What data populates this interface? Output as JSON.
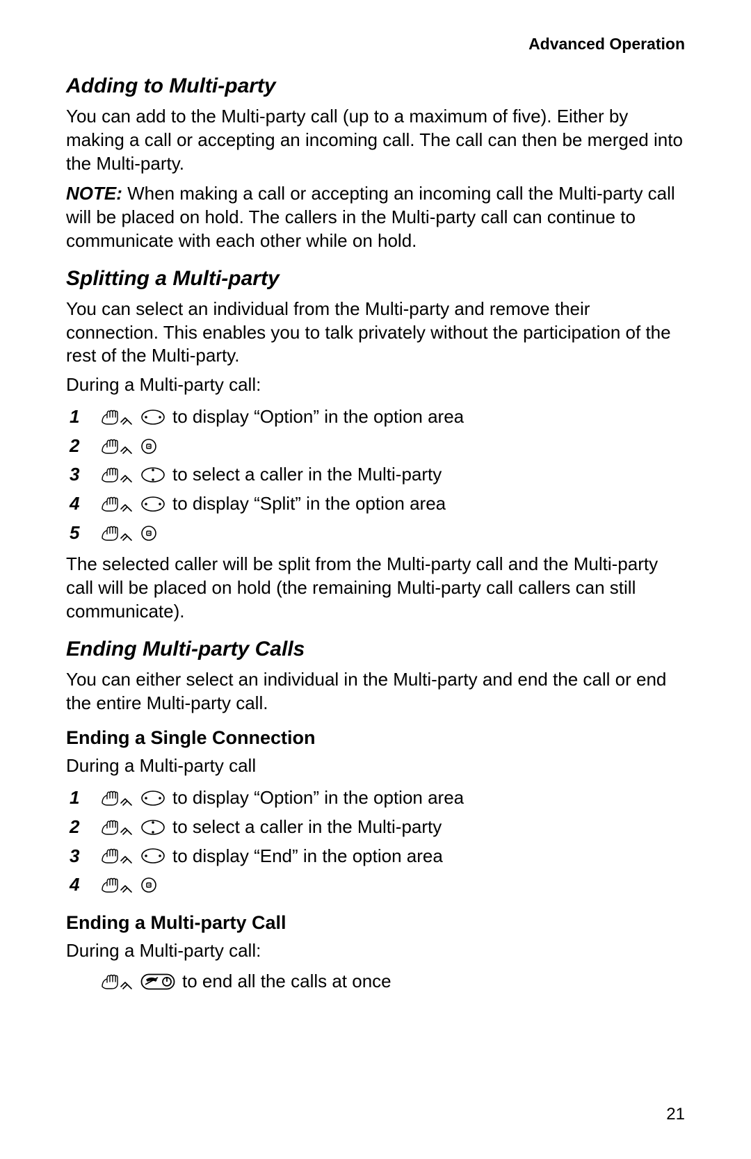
{
  "header": "Advanced Operation",
  "pageNumber": "21",
  "sections": {
    "adding": {
      "title": "Adding to Multi-party",
      "body": "You can add to the Multi-party call (up to a maximum of five). Either by making a call or accepting an incoming call. The call can then be merged into the Multi-party.",
      "noteLabel": "NOTE:",
      "noteBody": " When making a call or accepting an incoming call the Multi-party call will be placed on hold. The callers in the Multi-party call can continue to communicate with each other while on hold."
    },
    "splitting": {
      "title": "Splitting a Multi-party",
      "body": "You can select an individual from the Multi-party and remove their connection. This enables you to talk privately without the participation of the rest of the Multi-party.",
      "intro": "During a Multi-party call:",
      "steps": [
        {
          "n": "1",
          "text": " to display “Option” in the option area"
        },
        {
          "n": "2",
          "text": ""
        },
        {
          "n": "3",
          "text": " to select a caller in the Multi-party"
        },
        {
          "n": "4",
          "text": " to display “Split” in the option area"
        },
        {
          "n": "5",
          "text": ""
        }
      ],
      "after": "The selected caller will be split from the Multi-party call and the Multi-party call will be placed on hold (the remaining Multi-party call callers can still communicate)."
    },
    "ending": {
      "title": "Ending Multi-party Calls",
      "body": "You can either select an individual in the Multi-party and end the call or end the entire Multi-party call.",
      "sub1": {
        "title": "Ending a Single Connection",
        "intro": "During a Multi-party call",
        "steps": [
          {
            "n": "1",
            "text": " to display “Option” in the option area"
          },
          {
            "n": "2",
            "text": " to select a caller in the Multi-party"
          },
          {
            "n": "3",
            "text": " to display “End” in the option area"
          },
          {
            "n": "4",
            "text": ""
          }
        ]
      },
      "sub2": {
        "title": "Ending a Multi-party Call",
        "intro": "During a Multi-party call:",
        "stepText": " to end all the calls at once"
      }
    }
  }
}
